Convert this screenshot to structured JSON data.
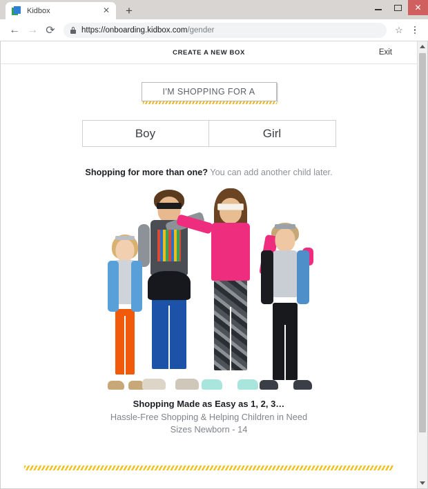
{
  "window": {
    "controls": {
      "minimize_label": "–",
      "maximize_label": "□",
      "close_label": "✕"
    }
  },
  "browser": {
    "tab": {
      "title": "Kidbox",
      "close_label": "✕",
      "favicon_name": "kidbox-book-favicon"
    },
    "new_tab_label": "+",
    "toolbar": {
      "back_label": "←",
      "forward_label": "→",
      "reload_label": "⟳",
      "url_secure": "https://onboarding.kidbox.com",
      "url_path": "/gender",
      "bookmark_label": "☆"
    }
  },
  "page": {
    "header": {
      "title": "CREATE A NEW BOX",
      "exit_label": "Exit"
    },
    "shopping_for": {
      "label": "I'M SHOPPING FOR A",
      "accent_color": "#efb91c"
    },
    "gender_options": [
      {
        "label": "Boy"
      },
      {
        "label": "Girl"
      }
    ],
    "note": {
      "bold": "Shopping for more than one?",
      "rest": " You can add another child later."
    },
    "hero": {
      "alt": "Four children modeling Kidbox clothing"
    },
    "captions": {
      "line1": "Shopping Made as Easy as 1, 2, 3…",
      "line2": "Hassle-Free Shopping & Helping Children in Need",
      "line3": "Sizes Newborn - 14"
    },
    "stripe_color": "#f0c01d"
  },
  "scrollbar": {
    "up_label": "▲",
    "down_label": "▼"
  }
}
